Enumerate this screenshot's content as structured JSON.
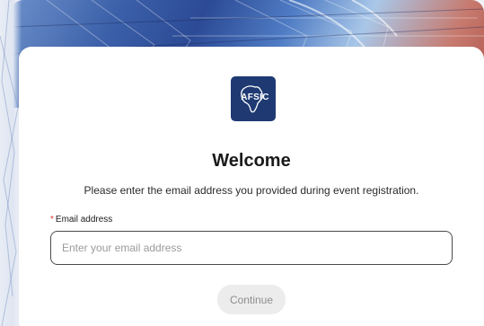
{
  "banner": {
    "colors": [
      "#6b8fc9",
      "#2c4a95",
      "#a9c7e8",
      "#b0564e"
    ]
  },
  "logo": {
    "text": "AFSIC",
    "background": "#1f3a73",
    "icon": "africa-outline-icon"
  },
  "welcome": {
    "title": "Welcome",
    "subtitle": "Please enter the email address you provided during event registration."
  },
  "form": {
    "required_marker": "*",
    "email_label": "Email address",
    "email_placeholder": "Enter your email address",
    "email_value": "",
    "continue_label": "Continue"
  },
  "colors": {
    "required": "#e0352b",
    "button_bg": "#ececec",
    "button_text": "#8e8e8e"
  }
}
